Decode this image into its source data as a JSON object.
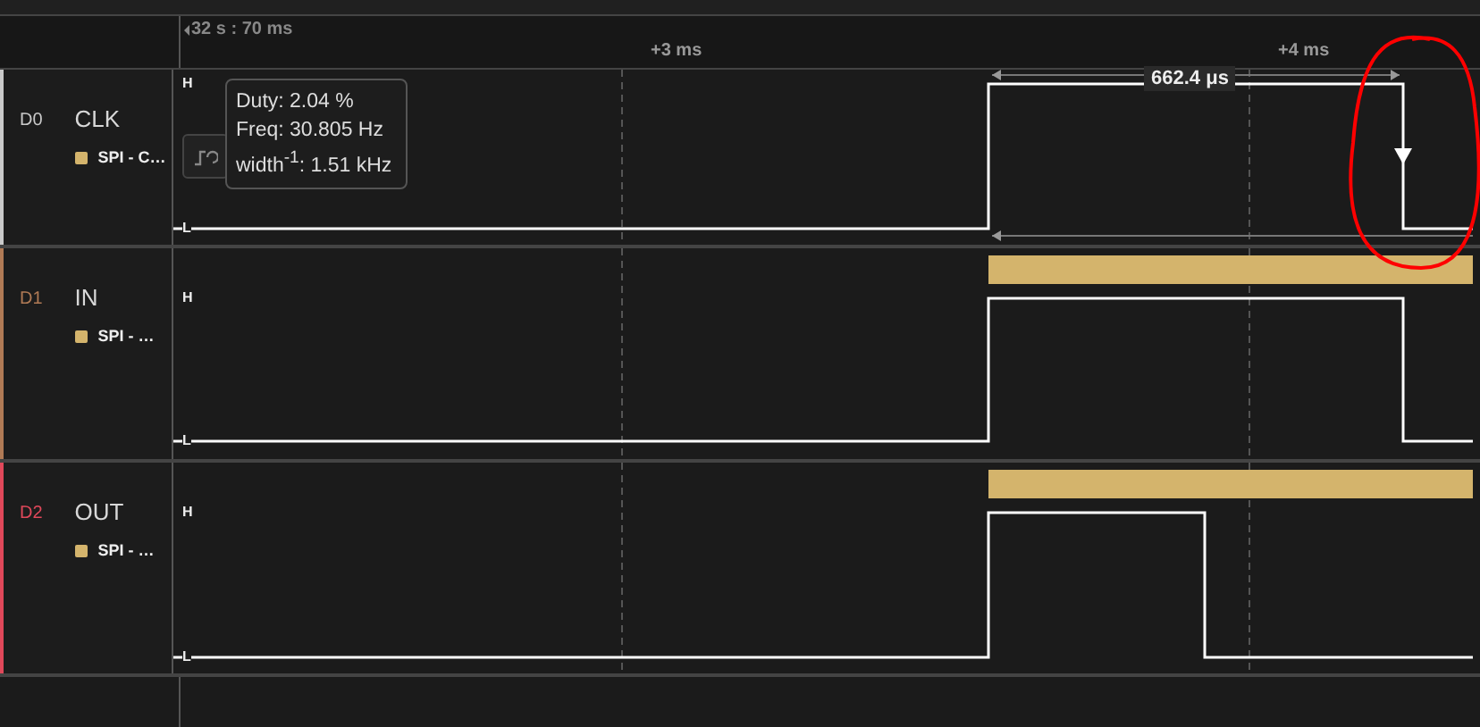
{
  "ruler": {
    "start": "32 s : 70 ms",
    "ticks": [
      "+3 ms",
      "+4 ms"
    ]
  },
  "channels": [
    {
      "id": "D0",
      "name": "CLK",
      "color": "#c9c9c9",
      "high_label": "H",
      "low_label": "L",
      "analyzer": {
        "label": "SPI - C…",
        "color": "#d4b46c"
      },
      "annotation_bar": false,
      "measurement": "662.4 μs",
      "edge_marker": true,
      "tooltip": [
        "Duty: 2.04 %",
        "Freq: 30.805 Hz",
        "width$^{-1}$: 1.51 kHz"
      ]
    },
    {
      "id": "D1",
      "name": "IN",
      "color": "#b07a55",
      "high_label": "H",
      "low_label": "L",
      "analyzer": {
        "label": "SPI - …",
        "color": "#d4b46c"
      },
      "annotation_bar": true,
      "edge_marker": false
    },
    {
      "id": "D2",
      "name": "OUT",
      "color": "#e0485a",
      "high_label": "H",
      "low_label": "L",
      "analyzer": {
        "label": "SPI - …",
        "color": "#d4b46c"
      },
      "annotation_bar": true,
      "edge_marker": false
    }
  ]
}
